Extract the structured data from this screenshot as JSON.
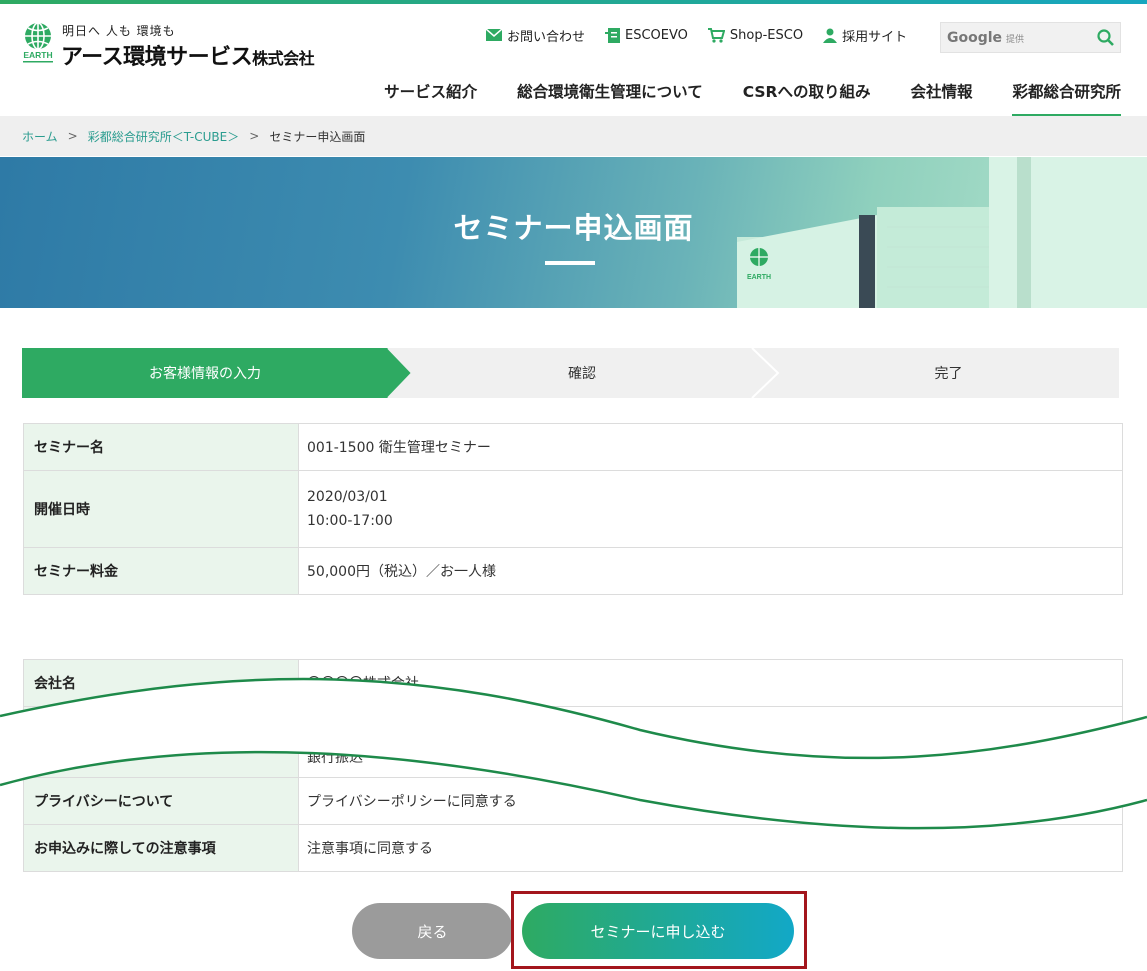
{
  "header": {
    "logo": {
      "tagline": "明日へ 人も 環境も",
      "name": "アース環境サービス",
      "suffix": "株式会社",
      "mark_text": "EARTH"
    },
    "util_nav": [
      {
        "icon": "mail-icon",
        "label": "お問い合わせ"
      },
      {
        "icon": "document-icon",
        "label": "ESCOEVO"
      },
      {
        "icon": "cart-icon",
        "label": "Shop-ESCO"
      },
      {
        "icon": "person-icon",
        "label": "採用サイト"
      }
    ],
    "search": {
      "brand": "Google",
      "provided": "提供",
      "icon": "search-icon"
    },
    "main_nav": [
      {
        "label": "サービス紹介",
        "active": false
      },
      {
        "label": "総合環境衛生管理について",
        "active": false
      },
      {
        "label": "CSRへの取り組み",
        "active": false
      },
      {
        "label": "会社情報",
        "active": false
      },
      {
        "label": "彩都総合研究所",
        "active": true
      }
    ]
  },
  "breadcrumb": {
    "home": "ホーム",
    "parent": "彩都総合研究所＜T-CUBE＞",
    "current": "セミナー申込画面",
    "separator": ">"
  },
  "hero": {
    "title": "セミナー申込画面",
    "building_sign": "EARTH"
  },
  "steps": [
    {
      "label": "お客様情報の入力",
      "active": true
    },
    {
      "label": "確認",
      "active": false
    },
    {
      "label": "完了",
      "active": false
    }
  ],
  "seminar_table": {
    "rows": [
      {
        "label": "セミナー名",
        "value": "001-1500 衛生管理セミナー"
      },
      {
        "label": "開催日時",
        "value": "2020/03/01",
        "value2": "10:00-17:00"
      },
      {
        "label": "セミナー料金",
        "value": "50,000円（税込）／お一人様"
      }
    ]
  },
  "applicant_table": {
    "rows": [
      {
        "label": "会社名",
        "value": "〇〇〇〇株式会社"
      },
      {
        "label": "",
        "value": "銀行振込"
      },
      {
        "label": "プライバシーについて",
        "value": "プライバシーポリシーに同意する"
      },
      {
        "label": "お申込みに際しての注意事項",
        "value": "注意事項に同意する"
      }
    ]
  },
  "buttons": {
    "back": "戻る",
    "submit": "セミナーに申し込む"
  },
  "colors": {
    "brand_green": "#2eaa62",
    "brand_teal": "#12a8c7",
    "highlight_red": "#a3161c",
    "th_background": "#eaf5ec"
  }
}
